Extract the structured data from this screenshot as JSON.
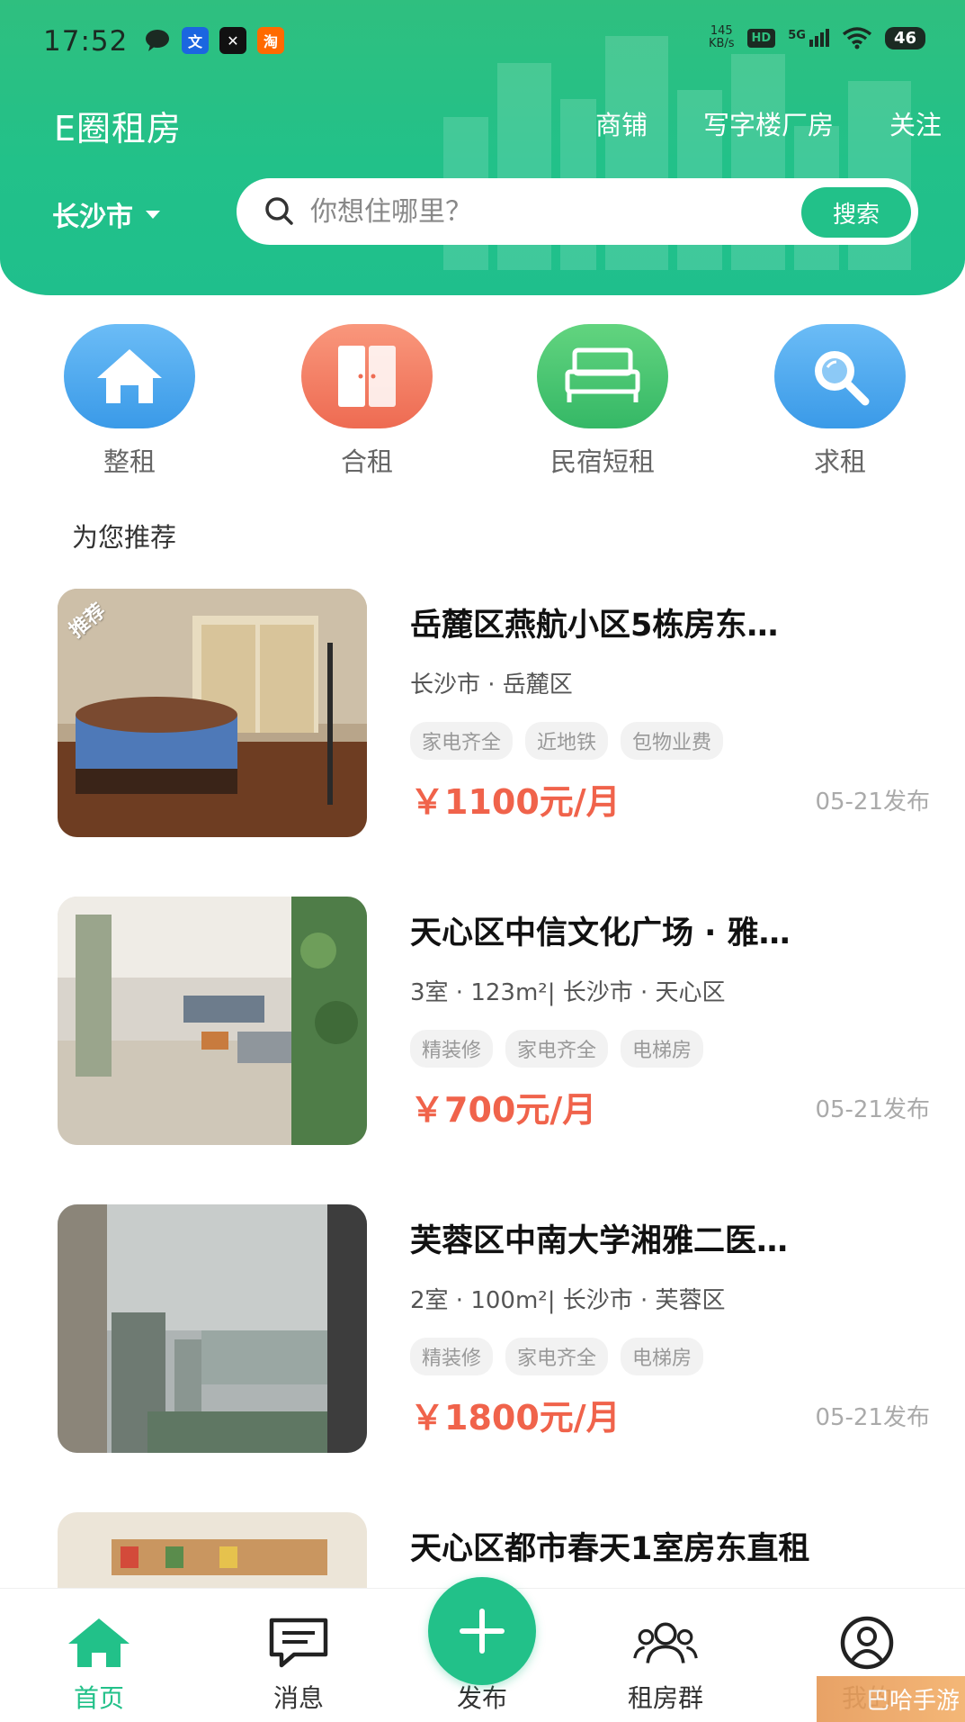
{
  "status_bar": {
    "time": "17:52",
    "net_speed_value": "145",
    "net_speed_unit": "KB/s",
    "hd": "HD",
    "signal": "5G",
    "battery": "46"
  },
  "header": {
    "app_title": "E圈租房",
    "nav": [
      "商铺",
      "写字楼厂房",
      "关注"
    ],
    "city": "长沙市",
    "search_placeholder": "你想住哪里？",
    "search_button": "搜索",
    "brand_color": "#22c189"
  },
  "categories": [
    {
      "label": "整租",
      "icon": "house-icon",
      "color": "#4aa8f0"
    },
    {
      "label": "合租",
      "icon": "door-icon",
      "color": "#f27d63"
    },
    {
      "label": "民宿短租",
      "icon": "bed-icon",
      "color": "#43c374"
    },
    {
      "label": "求租",
      "icon": "magnifier-icon",
      "color": "#4aa8f0"
    }
  ],
  "section_title": "为您推荐",
  "listings": [
    {
      "badge": "推荐",
      "title": "岳麓区燕航小区5栋房东…",
      "subtitle": "长沙市 · 岳麓区",
      "tags": [
        "家电齐全",
        "近地铁",
        "包物业费"
      ],
      "price": "￥1100元/月",
      "date": "05-21发布"
    },
    {
      "badge": "",
      "title": "天心区中信文化广场 · 雅…",
      "subtitle": "3室 · 123m²| 长沙市 · 天心区",
      "tags": [
        "精装修",
        "家电齐全",
        "电梯房"
      ],
      "price": "￥700元/月",
      "date": "05-21发布"
    },
    {
      "badge": "",
      "title": "芙蓉区中南大学湘雅二医…",
      "subtitle": "2室 · 100m²| 长沙市 · 芙蓉区",
      "tags": [
        "精装修",
        "家电齐全",
        "电梯房"
      ],
      "price": "￥1800元/月",
      "date": "05-21发布"
    },
    {
      "badge": "",
      "title": "天心区都市春天1室房东直租",
      "subtitle": "",
      "tags": [],
      "price": "",
      "date": ""
    }
  ],
  "tabbar": {
    "home": "首页",
    "messages": "消息",
    "publish": "发布",
    "groups": "租房群",
    "mine": "我的"
  },
  "watermark": "巴哈手游"
}
